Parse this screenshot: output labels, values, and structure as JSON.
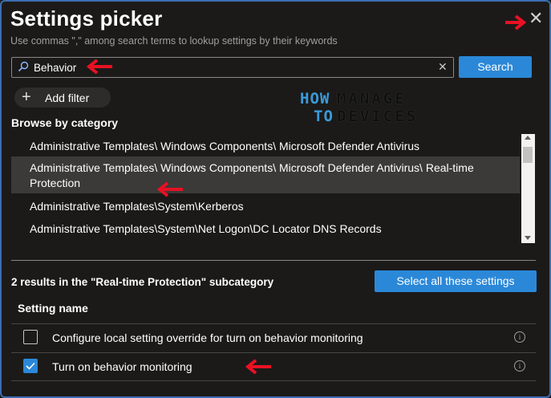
{
  "dialog": {
    "title": "Settings picker",
    "subtitle": "Use commas \",\" among search terms to lookup settings by their keywords",
    "close_icon": "close-icon"
  },
  "search": {
    "value": "Behavior",
    "button_label": "Search",
    "icon": "search-icon"
  },
  "filter": {
    "add_label": "Add filter"
  },
  "watermark": {
    "line1_left": "HOW",
    "line1_right": "MANAGE",
    "line2_left": "TO",
    "line2_right": "DEVICES"
  },
  "browse": {
    "heading": "Browse by category",
    "categories": [
      "Administrative Templates\\ Windows Components\\ Microsoft Defender Antivirus",
      "Administrative Templates\\ Windows Components\\ Microsoft Defender Antivirus\\ Real-time Protection",
      "Administrative Templates\\System\\Kerberos",
      "Administrative Templates\\System\\Net Logon\\DC Locator DNS Records"
    ],
    "selected_index": 1
  },
  "results": {
    "summary": "2 results in the \"Real-time Protection\" subcategory",
    "select_all_label": "Select all these settings",
    "column_header": "Setting name",
    "rows": [
      {
        "label": "Configure local setting override for turn on behavior monitoring",
        "checked": false,
        "info": "i"
      },
      {
        "label": "Turn on behavior monitoring",
        "checked": true,
        "info": "i"
      }
    ]
  },
  "colors": {
    "background": "#1b1a19",
    "accent": "#2b88d8",
    "annotation_arrow": "#e81123",
    "selected_row": "#3b3a39"
  }
}
